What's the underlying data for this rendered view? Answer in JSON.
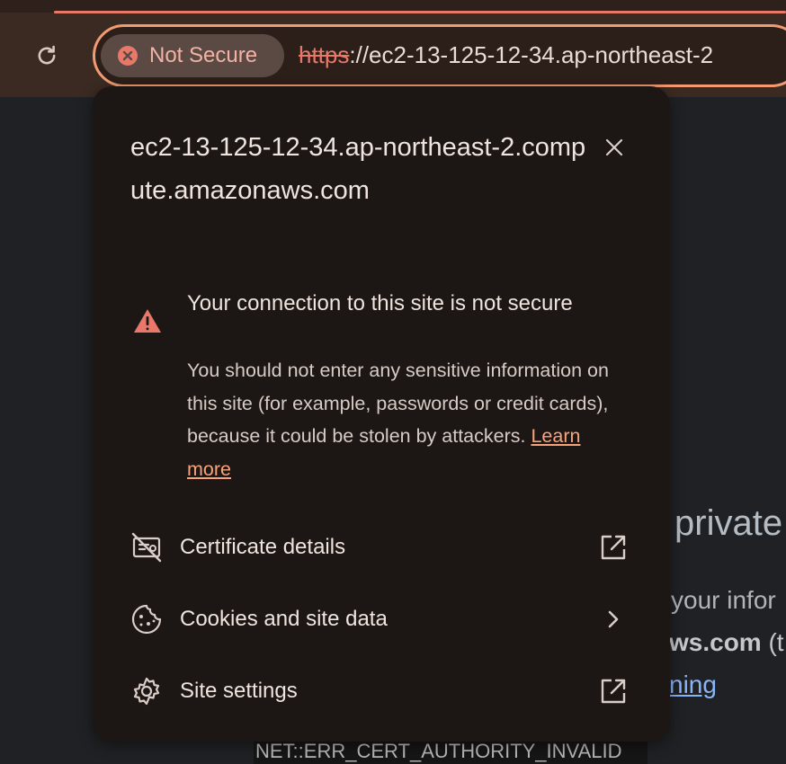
{
  "toolbar": {
    "reload_icon": "reload-icon"
  },
  "omnibox": {
    "security_chip": {
      "icon": "error-circle-icon",
      "label": "Not Secure"
    },
    "url_scheme": "https",
    "url_rest": "://ec2-13-125-12-34.ap-northeast-2"
  },
  "popup": {
    "title": "ec2-13-125-12-34.ap-northeast-2.compute.amazonaws.com",
    "close_icon": "close-icon",
    "warning": {
      "icon": "warning-triangle-icon",
      "heading": "Your connection to this site is not secure",
      "body": "You should not enter any sensitive information on this site (for example, passwords or credit cards), because it could be stolen by attackers.",
      "learn_more": "Learn more"
    },
    "menu": [
      {
        "label": "Certificate details",
        "icon": "certificate-off-icon",
        "trailing_icon": "open-in-new-icon"
      },
      {
        "label": "Cookies and site data",
        "icon": "cookie-icon",
        "trailing_icon": "chevron-right-icon"
      },
      {
        "label": "Site settings",
        "icon": "gear-icon",
        "trailing_icon": "open-in-new-icon"
      }
    ]
  },
  "background_page": {
    "heading_fragment": "private",
    "line1_fragment": "your infor",
    "line2_bold_fragment": "ws.com",
    "line2_rest_fragment": " (t",
    "link_fragment": "ning",
    "error_code": "NET::ERR_CERT_AUTHORITY_INVALID"
  },
  "colors": {
    "omnibox_border": "#f29b72",
    "warning_red": "#e8786a",
    "link_orange": "#f7a47c",
    "popup_bg": "#1c1614"
  }
}
